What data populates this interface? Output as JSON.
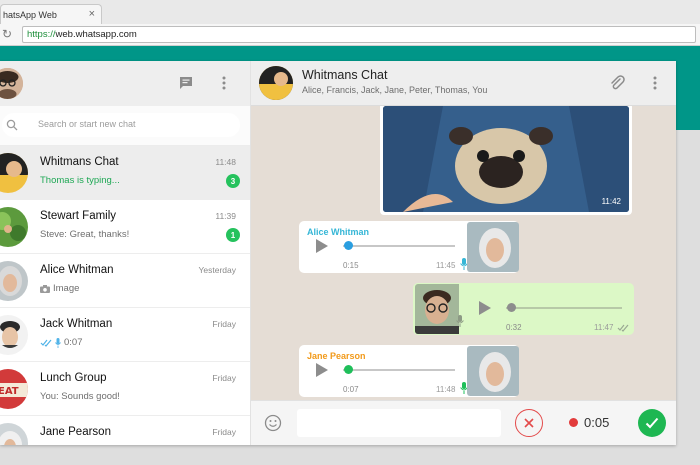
{
  "browser": {
    "tab_title": "hatsApp Web",
    "tab_close": "×",
    "url_scheme": "https://",
    "url_rest": "web.whatsapp.com"
  },
  "search": {
    "placeholder": "Search or start new chat"
  },
  "chats": [
    {
      "name": "Whitmans Chat",
      "time": "11:48",
      "preview": "Thomas is typing...",
      "badge": "3",
      "typing": true
    },
    {
      "name": "Stewart Family",
      "time": "11:39",
      "preview": "Steve: Great, thanks!",
      "badge": "1"
    },
    {
      "name": "Alice Whitman",
      "time": "Yesterday",
      "preview": "Image",
      "icon": "camera-icon"
    },
    {
      "name": "Jack Whitman",
      "time": "Friday",
      "preview": "0:07",
      "icon": "mic-icon"
    },
    {
      "name": "Lunch Group",
      "time": "Friday",
      "preview": "You: Sounds good!"
    },
    {
      "name": "Jane Pearson",
      "time": "Friday",
      "preview": ""
    }
  ],
  "conversation": {
    "title": "Whitmans Chat",
    "members": "Alice, Francis, Jack, Jane, Peter, Thomas, You"
  },
  "messages": {
    "image": {
      "time": "11:42"
    },
    "voice1": {
      "sender": "Alice Whitman",
      "duration": "0:15",
      "time": "11:45",
      "progress": 0.05
    },
    "voice2": {
      "duration": "0:32",
      "time": "11:47",
      "progress": 0.05
    },
    "voice3": {
      "sender": "Jane Pearson",
      "duration": "0:07",
      "time": "11:48",
      "progress": 0.05
    }
  },
  "composer": {
    "record_time": "0:05"
  },
  "colors": {
    "accent": "#009688",
    "badge": "#25c25d",
    "typing": "#1fa855",
    "sender_alice": "#35b6d6",
    "sender_jane": "#f29a1a",
    "play_dot_green": "#1fbf5a",
    "play_dot_blue": "#2a9ee0",
    "record_red": "#e23b3b"
  }
}
